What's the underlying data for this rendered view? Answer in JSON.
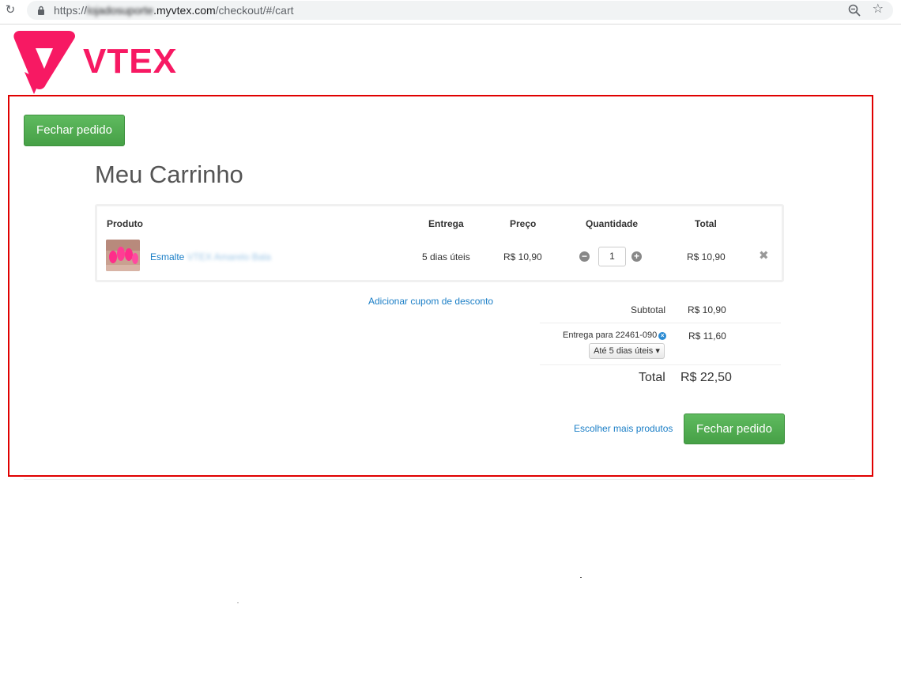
{
  "browser": {
    "url_prefix": "https://",
    "url_host_blurred": "lojadosuporte",
    "url_host": ".myvtex.com",
    "url_path": "/checkout/#/cart"
  },
  "brand": {
    "logo_text": "VTEX",
    "logo_tm": "™",
    "color": "#f71963"
  },
  "header": {
    "close_order_label": "Fechar pedido"
  },
  "cart": {
    "title": "Meu Carrinho",
    "columns": {
      "product": "Produto",
      "delivery": "Entrega",
      "price": "Preço",
      "quantity": "Quantidade",
      "total": "Total"
    },
    "items": [
      {
        "name": "Esmalte",
        "name_blurred": "VTEX Amarelo Bala",
        "delivery": "5 dias úteis",
        "price": "R$ 10,90",
        "quantity": "1",
        "total": "R$ 10,90"
      }
    ]
  },
  "coupon": {
    "link_label": "Adicionar cupom de desconto"
  },
  "summary": {
    "subtotal_label": "Subtotal",
    "subtotal_value": "R$ 10,90",
    "shipping_label": "Entrega para 22461-090",
    "shipping_value": "R$ 11,60",
    "shipping_option": "Até 5 dias úteis",
    "total_label": "Total",
    "total_value": "R$ 22,50"
  },
  "footer": {
    "more_products_label": "Escolher mais produtos",
    "close_order_label": "Fechar pedido"
  },
  "colors": {
    "accent_green": "#4cae4c",
    "link_blue": "#1a7ec6",
    "highlight_red": "#e00000"
  }
}
